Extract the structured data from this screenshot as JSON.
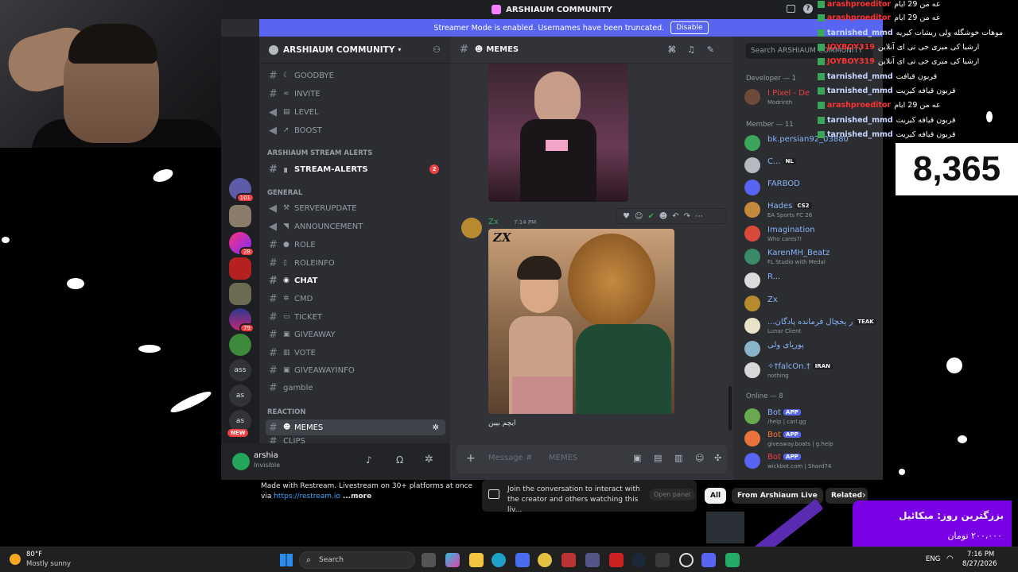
{
  "window": {
    "title": "ARSHIAUM COMMUNITY"
  },
  "streamer_banner": {
    "text": "Streamer Mode is enabled. Usernames have been truncated.",
    "button": "Disable"
  },
  "server": {
    "name": "ARSHIAUM COMMUNITY"
  },
  "guilds": [
    {
      "label": "",
      "badge": "101"
    },
    {
      "label": "",
      "badge": ""
    },
    {
      "label": "",
      "badge": "28"
    },
    {
      "label": "",
      "badge": ""
    },
    {
      "label": "",
      "badge": ""
    },
    {
      "label": "",
      "badge": "79"
    },
    {
      "label": "",
      "badge": ""
    },
    {
      "label": "ass",
      "badge": ""
    },
    {
      "label": "as",
      "badge": ""
    },
    {
      "label": "as",
      "badge": ""
    },
    {
      "label": "NEW",
      "badge": ""
    }
  ],
  "channels": {
    "goodbye": "GOODBYE",
    "invite": "INVITE",
    "level": "LEVEL",
    "boost": "BOOST",
    "cat_stream": "ARSHIAUM STREAM ALERTS",
    "stream_alerts": "STREAM-ALERTS",
    "stream_alerts_badge": "2",
    "cat_general": "GENERAL",
    "serverupdate": "SERVERUPDATE",
    "announcement": "ANNOUNCEMENT",
    "role": "ROLE",
    "roleinfo": "ROLEINFO",
    "chat": "CHAT",
    "cmd": "CMD",
    "ticket": "TICKET",
    "giveaway": "GIVEAWAY",
    "vote": "VOTE",
    "giveawayinfo": "GIVEAWAYINFO",
    "gamble": "gamble",
    "cat_reaction": "REACTION",
    "memes": "MEMES",
    "clips": "CLIPS"
  },
  "user": {
    "name": "arshia",
    "status": "Invisible"
  },
  "main": {
    "channel": "MEMES",
    "message_author": "Zx",
    "message_time": "7:14 PM",
    "image_text": "ZX",
    "message_text": "ایچم بیین",
    "input_placeholder": "Message #",
    "input_channel": "MEMES"
  },
  "members": {
    "search_placeholder": "Search ARSHIAUM COMMUNITY",
    "developer_header": "Developer",
    "developer_count": "— 1",
    "developer": {
      "name": "I Pixel - De",
      "status": "Modrinth"
    },
    "member_header": "Member — 11",
    "list": [
      {
        "name": "bk.persian92_03880",
        "status": "",
        "tag": ""
      },
      {
        "name": "C...",
        "status": "",
        "tag": "NL"
      },
      {
        "name": "FARBOD",
        "status": "",
        "tag": ""
      },
      {
        "name": "Hades",
        "status": "EA Sports FC 26",
        "tag": "CS2"
      },
      {
        "name": "Imagination",
        "status": "Who cares?!",
        "tag": ""
      },
      {
        "name": "KarenMH_Beatz",
        "status": "FL Studio with Medal",
        "tag": ""
      },
      {
        "name": "R...",
        "status": "",
        "tag": ""
      },
      {
        "name": "Zx",
        "status": "",
        "tag": ""
      },
      {
        "name": "...ر یخچال فرمانده پادگان",
        "status": "Lunar Client",
        "tag": "TEAK"
      },
      {
        "name": "پوریای ولی",
        "status": "",
        "tag": ""
      },
      {
        "name": "✧†falcOn.†",
        "status": "nothing",
        "tag": "IRAN"
      }
    ],
    "online_header": "Online — 8",
    "online": [
      {
        "name": "Bot",
        "status": "/help | carl.gg",
        "tag": "APP"
      },
      {
        "name": "Bot",
        "status": "giveaway.boats | g.help",
        "tag": "APP"
      },
      {
        "name": "Bot",
        "status": "wickbot.com | Shard74",
        "tag": "APP"
      }
    ]
  },
  "chat_overlay": [
    {
      "user": "arashproeditor",
      "msg": "عه من 29 ایام"
    },
    {
      "user": "arashproeditor",
      "msg": "عه من 29 ایام"
    },
    {
      "user": "tarnished_mmd",
      "msg": "موهات خوشگله ولی ریشات کیریه"
    },
    {
      "user": "JOYBOY319",
      "msg": "ارشیا کی میری جی تی ای آنلاین"
    },
    {
      "user": "JOYBOY319",
      "msg": "ارشیا کی میری جی تی ای آنلاین"
    },
    {
      "user": "tarnished_mmd",
      "msg": "قربون قیافت"
    },
    {
      "user": "tarnished_mmd",
      "msg": "قربون قیافه کیریت"
    },
    {
      "user": "arashproeditor",
      "msg": "عه من 29 ایام"
    },
    {
      "user": "tarnished_mmd",
      "msg": "قربون قیافه کیریت"
    },
    {
      "user": "tarnished_mmd",
      "msg": "قربون قیافه کیریت"
    }
  ],
  "viewer_count": "8,365",
  "description": {
    "line1": "Made with Restream. Livestream on 30+ platforms at once",
    "via": "via",
    "link": "https://restream.io",
    "more": "...more"
  },
  "join": {
    "text": "Join the conversation to interact with the creator and others watching this liv...",
    "button": "Open panel"
  },
  "chips": [
    "All",
    "From Arshiaum Live",
    "Related"
  ],
  "promo": {
    "line1": "بزرگترین روز: میکائیل",
    "line2": "۲۰۰،۰۰۰ تومان"
  },
  "taskbar": {
    "weather_temp": "80°F",
    "weather_desc": "Mostly sunny",
    "search": "Search",
    "lang": "ENG",
    "time": "7:16 PM",
    "date": "8/27/2026"
  },
  "colors": {
    "accent": "#5865f2",
    "danger": "#f23f43",
    "online": "#23a55a"
  }
}
